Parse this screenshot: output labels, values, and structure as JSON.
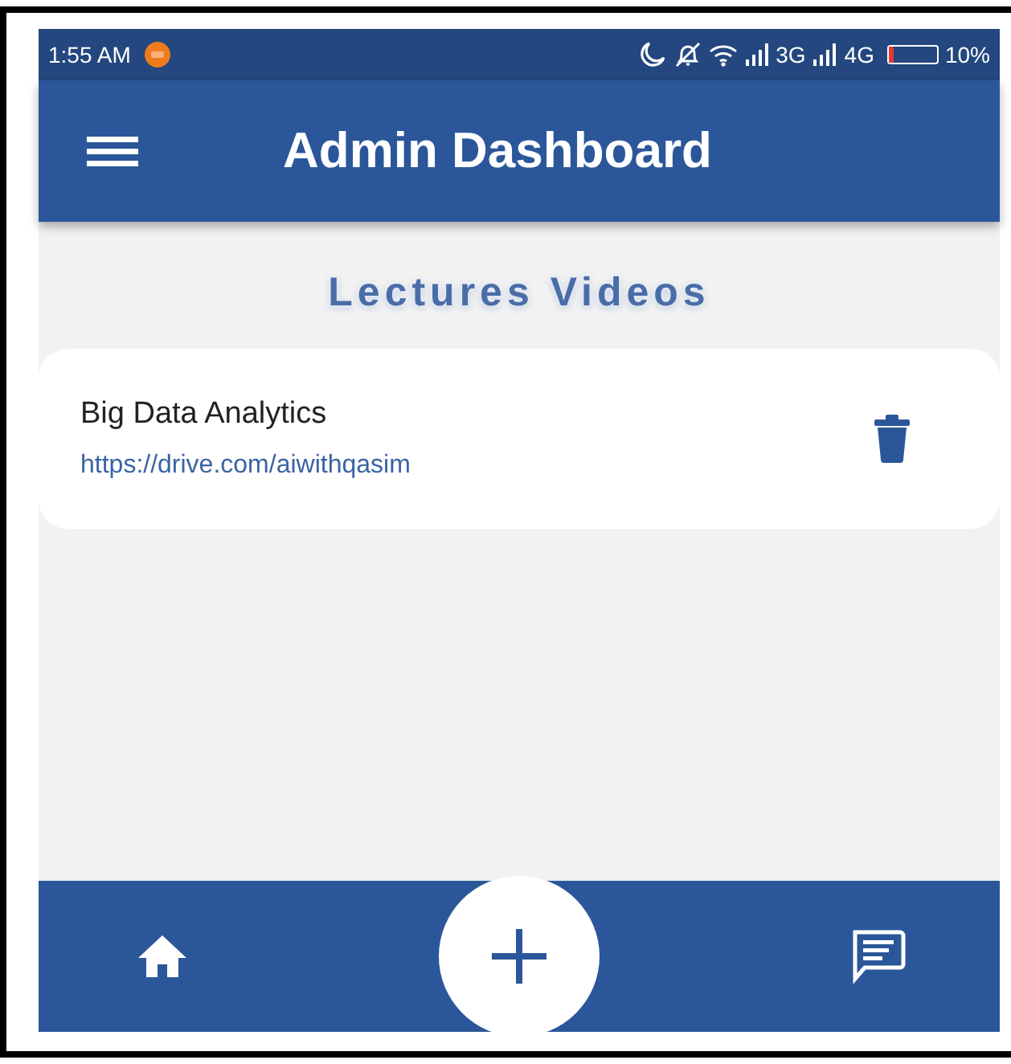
{
  "status_bar": {
    "time": "1:55 AM",
    "network_1": "3G",
    "network_2": "4G",
    "battery": {
      "text": "10%",
      "level": 0.1
    }
  },
  "app_bar": {
    "title": "Admin Dashboard"
  },
  "section_title": "Lectures Videos",
  "videos": [
    {
      "title": "Big Data Analytics",
      "url": "https://drive.com/aiwithqasim"
    }
  ]
}
